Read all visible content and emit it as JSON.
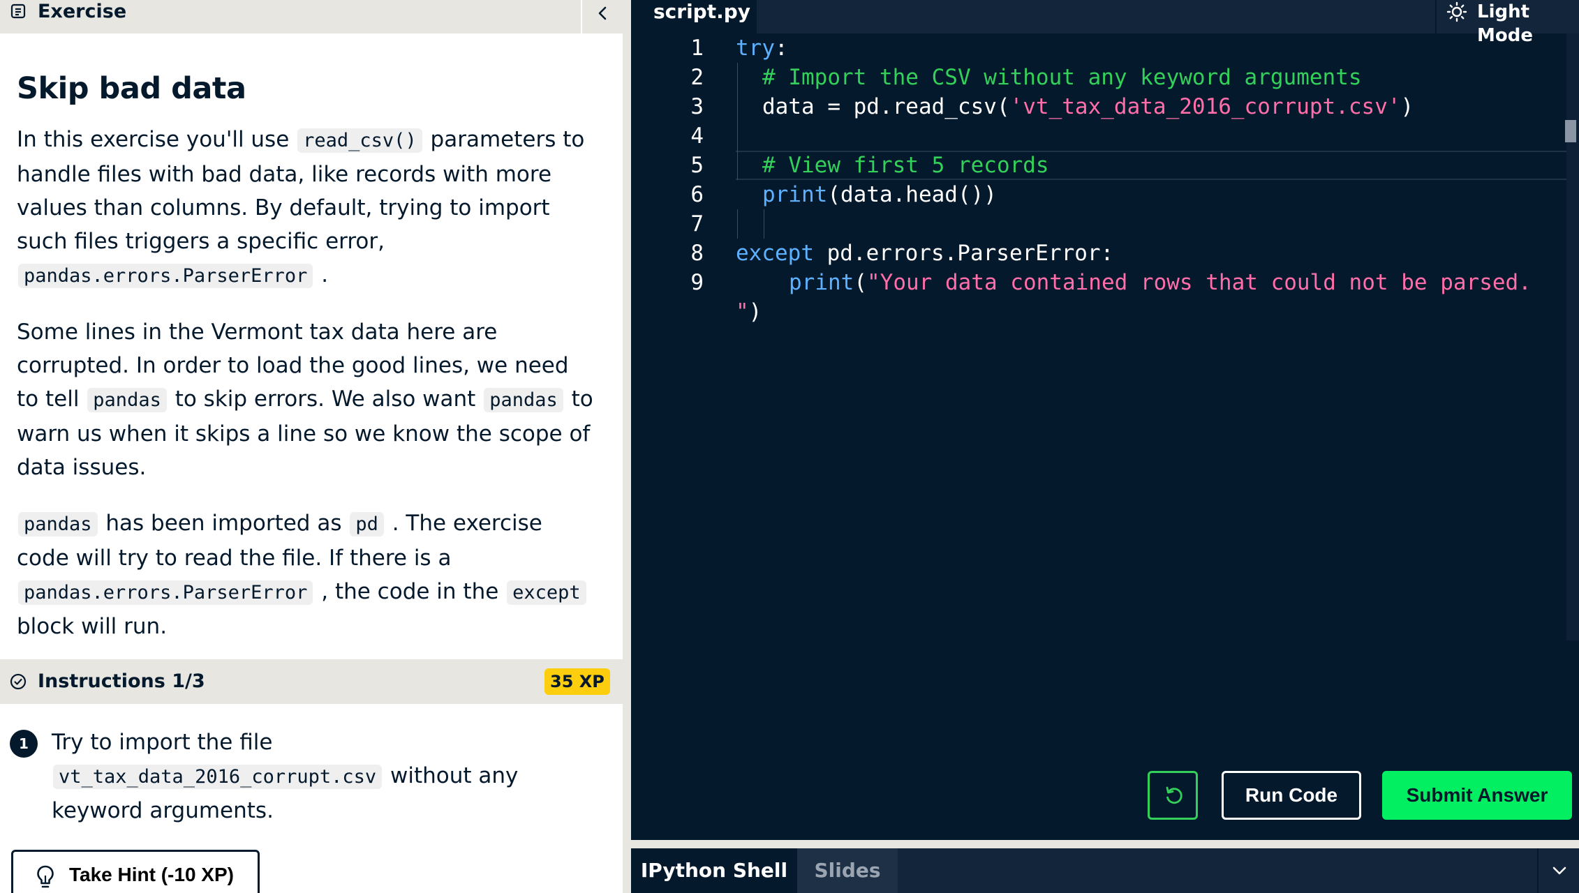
{
  "exercise_panel": {
    "header_title": "Exercise",
    "title": "Skip bad data",
    "para1": {
      "t1": "In this exercise you'll use ",
      "c1": "read_csv()",
      "t2": " parameters to handle files with bad data, like records with more values than columns. By default, trying to import such files triggers a specific error, ",
      "c2": "pandas.errors.ParserError",
      "t3": " ."
    },
    "para2": {
      "t1": "Some lines in the Vermont tax data here are corrupted. In order to load the good lines, we need to tell ",
      "c1": "pandas",
      "t2": " to skip errors. We also want ",
      "c2": "pandas",
      "t3": " to warn us when it skips a line so we know the scope of data issues."
    },
    "para3": {
      "c1": "pandas",
      "t1": " has been imported as ",
      "c2": "pd",
      "t2": " . The exercise code will try to read the file. If there is a ",
      "c3": "pandas.errors.ParserError",
      "t3": " , the code in the ",
      "c4": "except",
      "t4": " block will run."
    }
  },
  "instructions": {
    "label": "Instructions 1/3",
    "xp": "35 XP",
    "step": {
      "number": "1",
      "t1": "Try to import the file ",
      "c1": "vt_tax_data_2016_corrupt.csv",
      "t2": " without any keyword arguments."
    },
    "hint_label": "Take Hint (-10 XP)"
  },
  "editor": {
    "tab": "script.py",
    "mode_label": "Light Mode",
    "line_numbers": [
      "1",
      "2",
      "3",
      "4",
      "5",
      "6",
      "7",
      "8",
      "9"
    ],
    "code": {
      "l1_kw": "try",
      "l1_rest": ":",
      "l2_comment": "# Import the CSV without any keyword arguments",
      "l3_a": "data = pd.read_csv(",
      "l3_str": "'vt_tax_data_2016_corrupt.csv'",
      "l3_b": ")",
      "l5_comment": "# View first 5 records",
      "l6_fn": "print",
      "l6_rest": "(data.head())",
      "l8_kw": "except",
      "l8_rest": " pd.errors.ParserError:",
      "l9_fn": "print",
      "l9_a": "(",
      "l9_str": "\"Your data contained rows that could not be parsed.",
      "l9_wrap_str": "\"",
      "l9_wrap_rest": ")"
    },
    "run_label": "Run Code",
    "submit_label": "Submit Answer"
  },
  "bottom_tabs": {
    "shell": "IPython Shell",
    "slides": "Slides"
  },
  "colors": {
    "editor_bg": "#05192d",
    "keyword": "#5eb1ff",
    "comment": "#33d05a",
    "string": "#ff6ea9",
    "submit": "#03ef62",
    "xp_badge": "#fcce0d"
  }
}
